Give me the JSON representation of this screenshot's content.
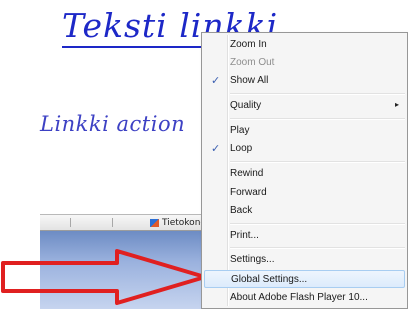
{
  "flash_content": {
    "link_text": "Teksti linkki",
    "action_text": "Linkki action"
  },
  "taskbar": {
    "item_label": "Tietokone",
    "icon": "computer-icon"
  },
  "context_menu": {
    "items": [
      {
        "label": "Zoom In",
        "enabled": true,
        "checked": false
      },
      {
        "label": "Zoom Out",
        "enabled": false,
        "checked": false
      },
      {
        "label": "Show All",
        "enabled": true,
        "checked": true
      },
      {
        "label": "Quality",
        "enabled": true,
        "checked": false,
        "has_submenu": true
      },
      {
        "label": "Play",
        "enabled": true,
        "checked": false
      },
      {
        "label": "Loop",
        "enabled": true,
        "checked": true
      },
      {
        "label": "Rewind",
        "enabled": true,
        "checked": false
      },
      {
        "label": "Forward",
        "enabled": true,
        "checked": false
      },
      {
        "label": "Back",
        "enabled": true,
        "checked": false
      },
      {
        "label": "Print...",
        "enabled": true,
        "checked": false
      },
      {
        "label": "Settings...",
        "enabled": true,
        "checked": false
      },
      {
        "label": "Global Settings...",
        "enabled": true,
        "checked": false,
        "highlighted": true
      },
      {
        "label": "About Adobe Flash Player 10...",
        "enabled": true,
        "checked": false
      }
    ],
    "check_glyph": "✓",
    "submenu_glyph": "▸"
  },
  "annotation": {
    "arrow_color": "#e02020",
    "points_to": "Global Settings..."
  }
}
